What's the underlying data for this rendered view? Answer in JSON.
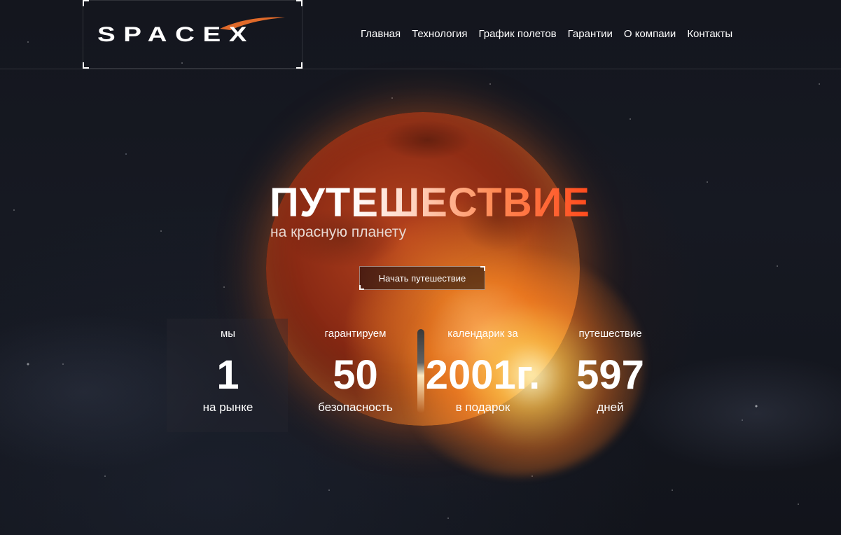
{
  "header": {
    "logo_text": "SPACEX",
    "nav": [
      "Главная",
      "Технология",
      "График полетов",
      "Гарантии",
      "О компаии",
      "Контакты"
    ]
  },
  "hero": {
    "title": "ПУТЕШЕСТВИЕ",
    "subtitle": "на красную планету",
    "cta": "Начать путешествие"
  },
  "stats": [
    {
      "label": "мы",
      "value": "1",
      "caption": "на рынке"
    },
    {
      "label": "гарантируем",
      "value": "50",
      "caption": "безопасность"
    },
    {
      "label": "календарик за",
      "value": "2001г.",
      "caption": "в подарок"
    },
    {
      "label": "путешествие",
      "value": "597",
      "caption": "дней"
    }
  ],
  "colors": {
    "accent": "#ff4a1c",
    "text": "#ffffff",
    "background": "#14161e"
  }
}
